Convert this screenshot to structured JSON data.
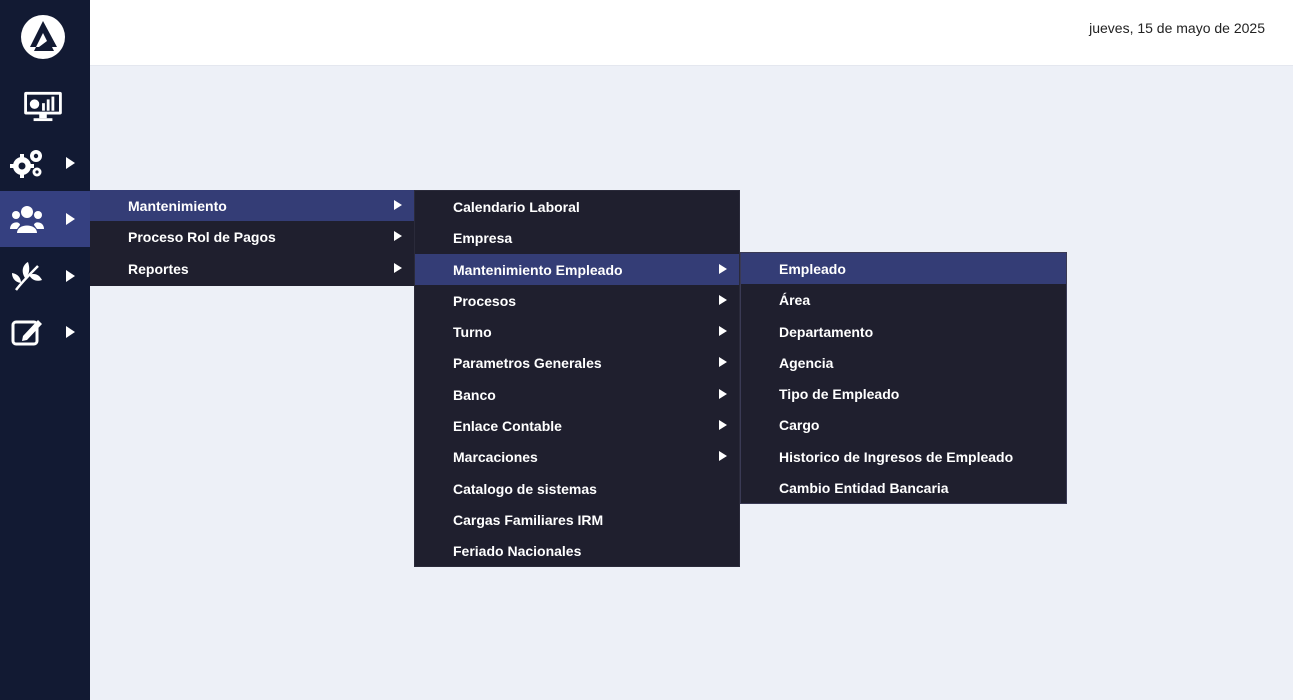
{
  "header": {
    "date": "jueves, 15 de mayo de 2025"
  },
  "sidebar": {
    "logo": "app-logo",
    "items": [
      {
        "icon": "dashboard-monitor-icon",
        "has_submenu": false
      },
      {
        "icon": "gears-icon",
        "has_submenu": true
      },
      {
        "icon": "users-group-icon",
        "has_submenu": true,
        "active": true
      },
      {
        "icon": "leaf-plant-icon",
        "has_submenu": true
      },
      {
        "icon": "edit-note-icon",
        "has_submenu": true
      }
    ]
  },
  "menu1": {
    "items": [
      {
        "label": "Mantenimiento",
        "has_submenu": true,
        "active": true
      },
      {
        "label": "Proceso Rol de Pagos",
        "has_submenu": true
      },
      {
        "label": "Reportes",
        "has_submenu": true
      }
    ]
  },
  "menu2": {
    "items": [
      {
        "label": "Calendario Laboral",
        "has_submenu": false
      },
      {
        "label": "Empresa",
        "has_submenu": false
      },
      {
        "label": "Mantenimiento Empleado",
        "has_submenu": true,
        "active": true
      },
      {
        "label": "Procesos",
        "has_submenu": true
      },
      {
        "label": "Turno",
        "has_submenu": true
      },
      {
        "label": "Parametros Generales",
        "has_submenu": true
      },
      {
        "label": "Banco",
        "has_submenu": true
      },
      {
        "label": "Enlace Contable",
        "has_submenu": true
      },
      {
        "label": "Marcaciones",
        "has_submenu": true
      },
      {
        "label": "Catalogo de sistemas",
        "has_submenu": false
      },
      {
        "label": "Cargas Familiares IRM",
        "has_submenu": false
      },
      {
        "label": "Feriado Nacionales",
        "has_submenu": false
      }
    ]
  },
  "menu3": {
    "items": [
      {
        "label": "Empleado",
        "active": true
      },
      {
        "label": "Área"
      },
      {
        "label": "Departamento"
      },
      {
        "label": "Agencia"
      },
      {
        "label": "Tipo de Empleado"
      },
      {
        "label": "Cargo"
      },
      {
        "label": "Historico de Ingresos de Empleado"
      },
      {
        "label": "Cambio Entidad Bancaria"
      }
    ]
  },
  "colors": {
    "sidebar_bg": "#121a33",
    "sidebar_active": "#354080",
    "menu_bg": "#1f1f2e",
    "menu_active": "#343d76",
    "page_bg": "#edf0f7"
  }
}
